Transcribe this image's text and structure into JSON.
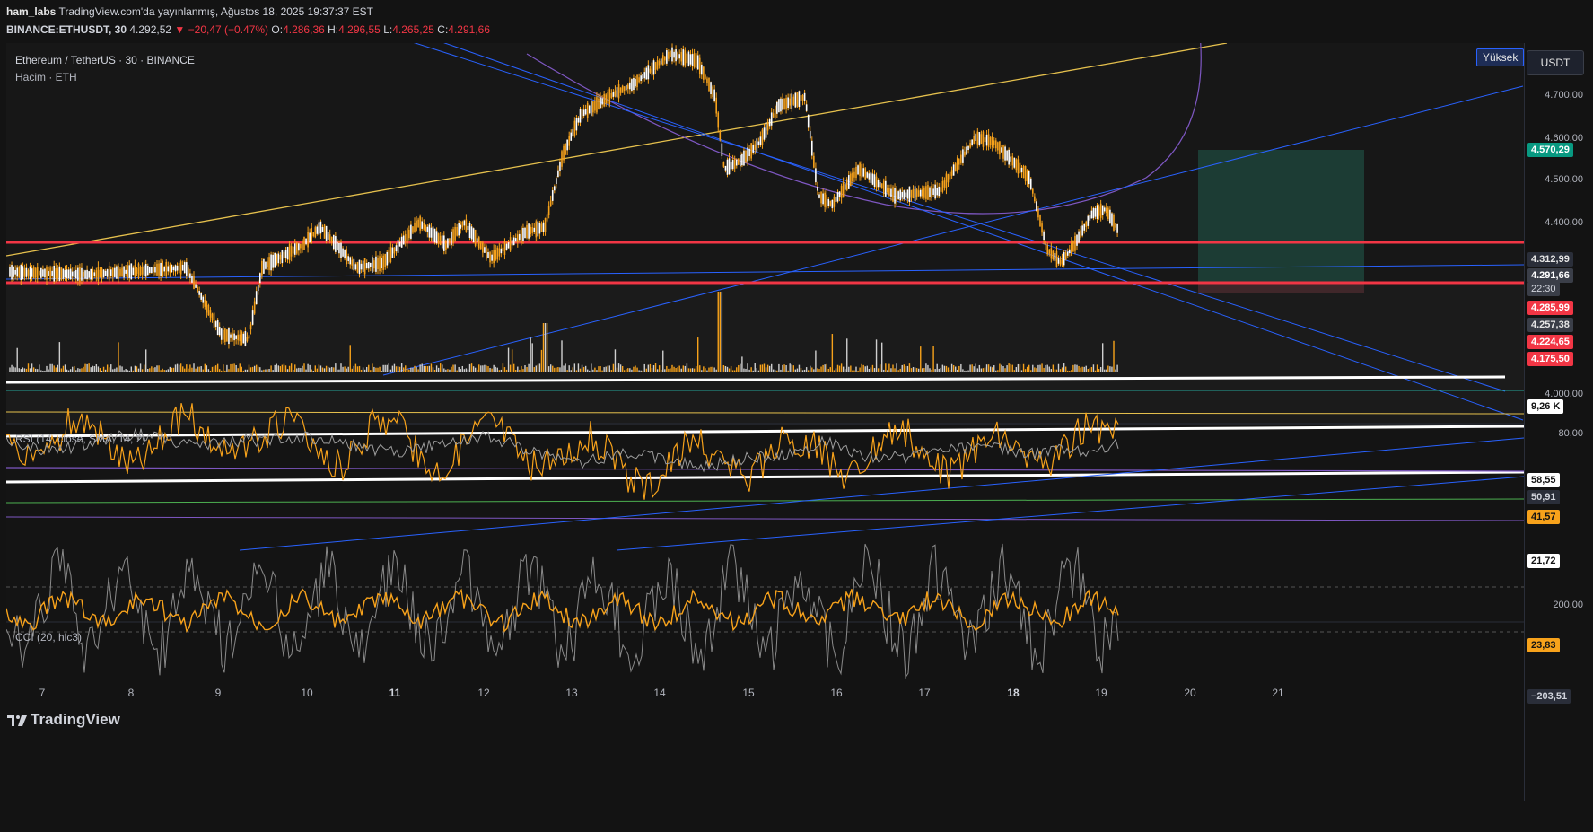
{
  "header": {
    "user": "ham_labs",
    "published": "TradingView.com'da yayınlanmış, Ağustos 18, 2025 19:37:37 EST",
    "symbol": "BINANCE:ETHUSDT, 30",
    "last": "4.292,52",
    "change_arrow": "▼",
    "change": "−20,47 (−0.47%)",
    "o_label": "O:",
    "o": "4.286,36",
    "h_label": "H:",
    "h": "4.296,55",
    "l_label": "L:",
    "l": "4.265,25",
    "c_label": "C:",
    "c": "4.291,66"
  },
  "panes": {
    "main_title": "Ethereum / TetherUS · 30 · BINANCE",
    "volume_title": "Hacim · ETH",
    "rsi_title": "RSI (14, close, SMA, 14, 2)",
    "cci_title": "CCI (20, hlc3)"
  },
  "axis": {
    "currency": "USDT",
    "scale_mode": "Yüksek",
    "price_ticks": [
      "4.700,00",
      "4.600,00",
      "4.500,00",
      "4.400,00",
      "4.000,00"
    ],
    "tags": {
      "tp": "4.570,29",
      "t1": "4.312,99",
      "current": "4.291,66",
      "countdown": "22:30",
      "r1": "4.285,99",
      "t2": "4.257,38",
      "r2": "4.224,65",
      "r3": "4.175,50",
      "volume": "9,26 K"
    },
    "rsi_ticks": [
      "80,00"
    ],
    "rsi_tags": [
      "58,55",
      "50,91",
      "41,57",
      "21,72"
    ],
    "cci_ticks": [
      "200,00"
    ],
    "cci_tags": [
      "23,83",
      "−203,51"
    ]
  },
  "dates": [
    "7",
    "8",
    "9",
    "10",
    "11",
    "12",
    "13",
    "14",
    "15",
    "16",
    "17",
    "18",
    "19",
    "20",
    "21"
  ],
  "colors": {
    "background": "#131313",
    "candle": "#f7a21b",
    "support_line": "#f23645",
    "trend_line": "#2962ff",
    "yellow_line": "#e5c04d",
    "arc": "#7e57c2",
    "target_zone": "#1f4a3f",
    "tag_green": "#089981",
    "tag_red": "#f23645",
    "tag_gray": "#3a3e48"
  },
  "branding": {
    "logo": "TradingView"
  }
}
